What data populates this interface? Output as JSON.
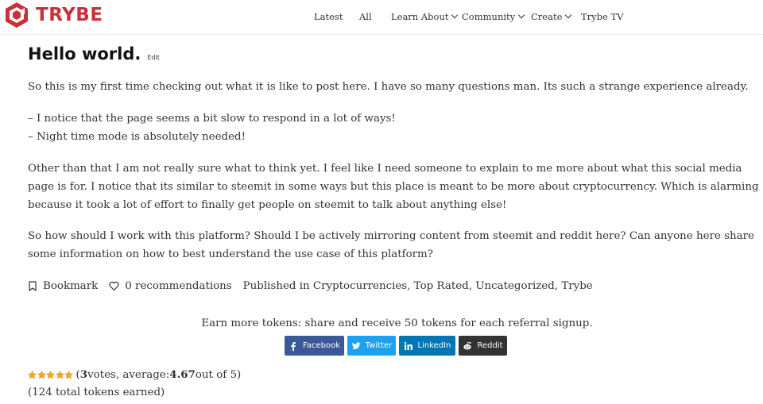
{
  "brand": {
    "name": "TRYBE",
    "color": "#c8303a"
  },
  "nav": {
    "items": [
      {
        "label": "Latest",
        "dropdown": false
      },
      {
        "label": "All",
        "dropdown": false
      },
      {
        "label": "Learn About",
        "dropdown": true
      },
      {
        "label": "Community",
        "dropdown": true
      },
      {
        "label": "Create",
        "dropdown": true
      },
      {
        "label": "Trybe TV",
        "dropdown": false
      }
    ]
  },
  "post": {
    "title": "Hello world.",
    "edit_label": "Edit",
    "paragraphs": [
      "So this is my first time checking out what it is like to post here. I have so many questions man. Its such a strange experience already.",
      "Other than that I am not really sure what to think yet. I feel like I need someone to explain to me more about what this social media page is for. I notice that its similar to steemit in some ways but this place is meant to be more about cryptocurrency. Which is alarming because it took a lot of effort to finally get people on steemit to talk about anything else!",
      "So how should I work with this platform? Should I be actively mirroring content from steemit and reddit here? Can anyone here share some information on how to best understand the use case of this platform?"
    ],
    "list": [
      "– I notice that the page seems a bit slow to respond in a lot of ways!",
      "– Night time mode is absolutely needed!"
    ]
  },
  "meta": {
    "bookmark_label": "Bookmark",
    "recommendations_label": "0 recommendations",
    "published_prefix": "Published in",
    "categories": [
      "Cryptocurrencies",
      "Top Rated",
      "Uncategorized",
      "Trybe"
    ]
  },
  "share": {
    "prompt": "Earn more tokens: share and receive 50 tokens for each referral signup.",
    "buttons": [
      {
        "label": "Facebook",
        "icon": "facebook-icon",
        "color": "#3b5998"
      },
      {
        "label": "Twitter",
        "icon": "twitter-icon",
        "color": "#1da1f2"
      },
      {
        "label": "LinkedIn",
        "icon": "linkedin-icon",
        "color": "#0077b5"
      },
      {
        "label": "Reddit",
        "icon": "reddit-icon",
        "color": "#333333"
      }
    ]
  },
  "rating": {
    "stars": 5,
    "open_paren": "(",
    "votes": "3",
    "votes_text": " votes, average: ",
    "average": "4.67",
    "scale_text": " out of 5)"
  },
  "tokens_earned": "(124 total tokens earned)"
}
